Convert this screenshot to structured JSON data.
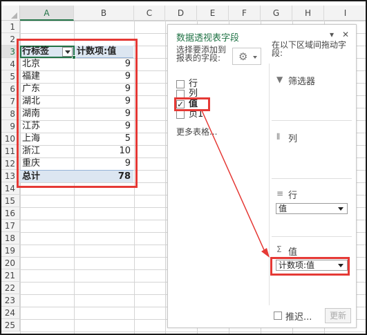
{
  "spreadsheet": {
    "columns": [
      "A",
      "B",
      "C",
      "D",
      "E",
      "F",
      "G",
      "H",
      "I"
    ],
    "active_column": "A",
    "rows": [
      "1",
      "2",
      "3",
      "4",
      "5",
      "6",
      "7",
      "8",
      "9",
      "10",
      "11",
      "12",
      "13",
      "14",
      "15",
      "16",
      "17",
      "18",
      "19",
      "20",
      "21",
      "22",
      "23",
      "24",
      "25"
    ],
    "active_row": "3"
  },
  "pivot": {
    "row_label_header": "行标签",
    "value_header": "计数项:值",
    "rows": [
      {
        "label": "北京",
        "value": "9"
      },
      {
        "label": "福建",
        "value": "9"
      },
      {
        "label": "广东",
        "value": "9"
      },
      {
        "label": "湖北",
        "value": "9"
      },
      {
        "label": "湖南",
        "value": "9"
      },
      {
        "label": "江苏",
        "value": "9"
      },
      {
        "label": "上海",
        "value": "5"
      },
      {
        "label": "浙江",
        "value": "10"
      },
      {
        "label": "重庆",
        "value": "9"
      }
    ],
    "total_label": "总计",
    "total_value": "78"
  },
  "field_list": {
    "title": "数据透视表字段",
    "pin_glyph": "▾",
    "close_glyph": "✕",
    "choose_fields_text": "选择要添加到报表的字段:",
    "area_text": "在以下区域间拖动字段:",
    "fields": [
      {
        "label": "行",
        "checked": false
      },
      {
        "label": "列",
        "checked": false
      },
      {
        "label": "值",
        "checked": true
      },
      {
        "label": "页1",
        "checked": false
      }
    ],
    "more_tables": "更多表格...",
    "areas": {
      "filters": {
        "label": "筛选器",
        "icon": "filter-icon"
      },
      "columns": {
        "label": "列",
        "icon": "columns-icon"
      },
      "rows": {
        "label": "行",
        "icon": "rows-icon",
        "item": "值"
      },
      "values": {
        "label": "值",
        "icon": "sigma-icon",
        "item": "计数项:值"
      }
    },
    "defer_label": "推迟...",
    "update_label": "更新"
  },
  "colors": {
    "accent": "#217346",
    "highlight": "#e53935",
    "pivot_header": "#dce6f1"
  }
}
